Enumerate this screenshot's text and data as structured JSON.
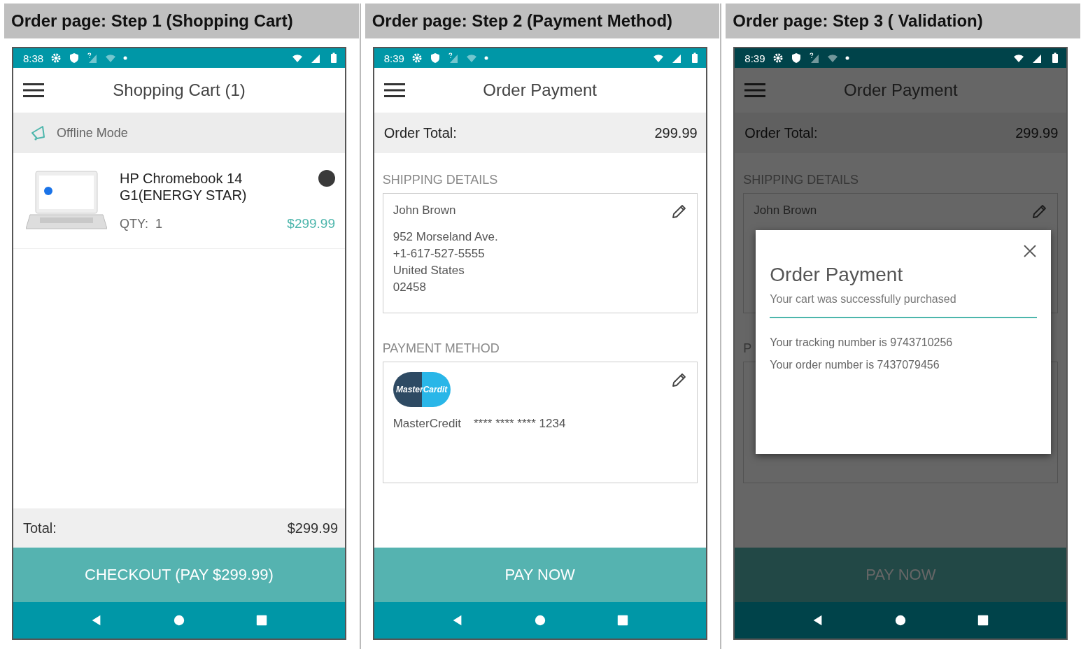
{
  "panels": [
    {
      "kind": "cart",
      "heading": "Order page: Step 1 (Shopping Cart)",
      "dimmed": false,
      "time": "8:38",
      "title": "Shopping Cart (1)",
      "banner": "Offline Mode",
      "items": [
        {
          "name": "HP Chromebook 14 G1(ENERGY STAR)",
          "qty_label": "QTY:",
          "qty": "1",
          "price": "$299.99"
        }
      ],
      "total_label": "Total:",
      "total": "$299.99",
      "action": "CHECKOUT (PAY $299.99)"
    },
    {
      "kind": "payment",
      "heading": "Order page: Step 2 (Payment Method)",
      "dimmed": false,
      "time": "8:39",
      "title": "Order Payment",
      "total_label": "Order Total:",
      "total": "299.99",
      "shipping": {
        "label": "SHIPPING DETAILS",
        "name": "John Brown",
        "lines": [
          "952 Morseland Ave.",
          "+1-617-527-5555",
          "United States",
          "02458"
        ]
      },
      "payment": {
        "label": "PAYMENT METHOD",
        "logo_text": "MasterCardit",
        "card_name": "MasterCredit",
        "card_number": "**** **** **** 1234"
      },
      "action": "PAY NOW"
    },
    {
      "kind": "payment",
      "heading": "Order page: Step 3 ( Validation)",
      "dimmed": true,
      "time": "8:39",
      "title": "Order Payment",
      "total_label": "Order Total:",
      "total": "299.99",
      "shipping": {
        "label": "SHIPPING DETAILS",
        "name": "John Brown"
      },
      "payment": {
        "label": "P"
      },
      "action": "PAY NOW",
      "dialog": {
        "title": "Order Payment",
        "subtitle": "Your cart was successfully purchased",
        "lines": [
          "Your tracking number is 9743710256",
          "Your order number is 7437079456"
        ]
      }
    }
  ]
}
